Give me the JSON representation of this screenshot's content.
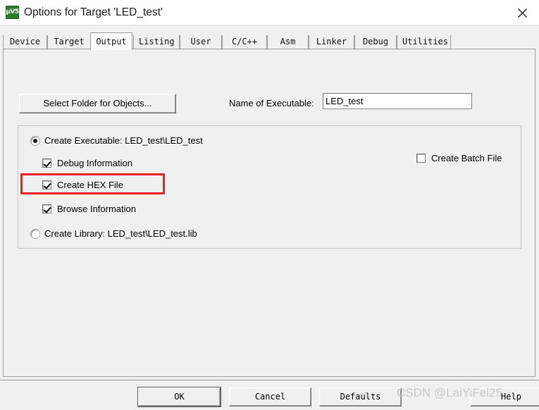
{
  "window": {
    "title": "Options for Target 'LED_test'",
    "icon": "keil-uvision5-icon",
    "icon_glyph": "µV5",
    "close_icon": "close-icon"
  },
  "tabs": [
    {
      "label": "Device",
      "selected": false
    },
    {
      "label": "Target",
      "selected": false
    },
    {
      "label": "Output",
      "selected": true
    },
    {
      "label": "Listing",
      "selected": false
    },
    {
      "label": "User",
      "selected": false
    },
    {
      "label": "C/C++",
      "selected": false
    },
    {
      "label": "Asm",
      "selected": false
    },
    {
      "label": "Linker",
      "selected": false
    },
    {
      "label": "Debug",
      "selected": false
    },
    {
      "label": "Utilities",
      "selected": false
    }
  ],
  "output_page": {
    "select_folder_button": "Select Folder for Objects...",
    "executable_label": "Name of Executable:",
    "executable_value": "LED_test",
    "executable_placeholder": "",
    "create_executable": {
      "label": "Create Executable:  LED_test\\LED_test",
      "checked": true
    },
    "debug_information": {
      "label": "Debug Information",
      "checked": true
    },
    "create_hex_file": {
      "label": "Create HEX File",
      "checked": true
    },
    "browse_information": {
      "label": "Browse Information",
      "checked": true
    },
    "create_library": {
      "label": "Create Library:  LED_test\\LED_test.lib",
      "checked": false
    },
    "create_batch_file": {
      "label": "Create Batch File",
      "checked": false
    },
    "highlight_color": "#ee2222",
    "highlight_target": "create_hex_file"
  },
  "footer": {
    "ok": "OK",
    "cancel": "Cancel",
    "defaults": "Defaults",
    "help": "Help"
  },
  "watermark": "CSDN @LaiYiFei25"
}
